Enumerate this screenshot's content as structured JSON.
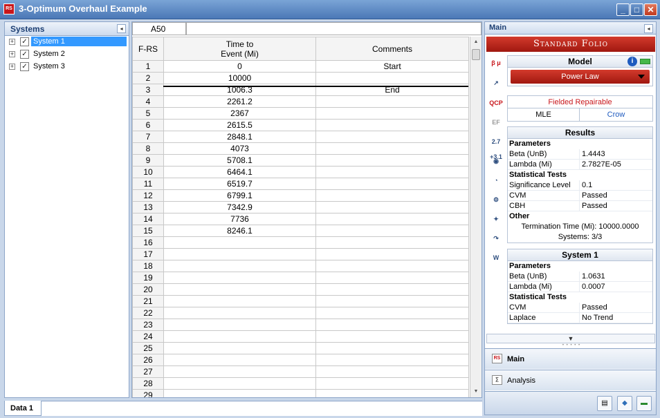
{
  "window": {
    "title": "3-Optimum Overhaul Example",
    "app_icon": "rs-app-icon",
    "min_label": "_",
    "max_label": "□",
    "close_label": "✕"
  },
  "systems_panel": {
    "title": "Systems",
    "collapse_glyph": "◂",
    "items": [
      {
        "label": "System 1",
        "checked": "✓",
        "expander": "+"
      },
      {
        "label": "System 2",
        "checked": "✓",
        "expander": "+"
      },
      {
        "label": "System 3",
        "checked": "✓",
        "expander": "+"
      }
    ]
  },
  "bottom_tab": {
    "label": "Data 1"
  },
  "grid": {
    "cell_ref": "A50",
    "formula": "",
    "columns": {
      "row_header": "F-RS",
      "time_line1": "Time to",
      "time_line2": "Event (Mi)",
      "comments": "Comments"
    },
    "rows": [
      {
        "n": "1",
        "time": "0",
        "comment": "Start"
      },
      {
        "n": "2",
        "time": "10000",
        "comment": ""
      },
      {
        "n": "3",
        "time": "1006.3",
        "comment": "End"
      },
      {
        "n": "4",
        "time": "2261.2",
        "comment": ""
      },
      {
        "n": "5",
        "time": "2367",
        "comment": ""
      },
      {
        "n": "6",
        "time": "2615.5",
        "comment": ""
      },
      {
        "n": "7",
        "time": "2848.1",
        "comment": ""
      },
      {
        "n": "8",
        "time": "4073",
        "comment": ""
      },
      {
        "n": "9",
        "time": "5708.1",
        "comment": ""
      },
      {
        "n": "10",
        "time": "6464.1",
        "comment": ""
      },
      {
        "n": "11",
        "time": "6519.7",
        "comment": ""
      },
      {
        "n": "12",
        "time": "6799.1",
        "comment": ""
      },
      {
        "n": "13",
        "time": "7342.9",
        "comment": ""
      },
      {
        "n": "14",
        "time": "7736",
        "comment": ""
      },
      {
        "n": "15",
        "time": "8246.1",
        "comment": ""
      },
      {
        "n": "16",
        "time": "",
        "comment": ""
      },
      {
        "n": "17",
        "time": "",
        "comment": ""
      },
      {
        "n": "18",
        "time": "",
        "comment": ""
      },
      {
        "n": "19",
        "time": "",
        "comment": ""
      },
      {
        "n": "20",
        "time": "",
        "comment": ""
      },
      {
        "n": "21",
        "time": "",
        "comment": ""
      },
      {
        "n": "22",
        "time": "",
        "comment": ""
      },
      {
        "n": "23",
        "time": "",
        "comment": ""
      },
      {
        "n": "24",
        "time": "",
        "comment": ""
      },
      {
        "n": "25",
        "time": "",
        "comment": ""
      },
      {
        "n": "26",
        "time": "",
        "comment": ""
      },
      {
        "n": "27",
        "time": "",
        "comment": ""
      },
      {
        "n": "28",
        "time": "",
        "comment": ""
      },
      {
        "n": "29",
        "time": "",
        "comment": ""
      }
    ]
  },
  "main_panel": {
    "title": "Main",
    "collapse_glyph": "◂",
    "banner": "Standard Folio",
    "toolbar_icons": [
      {
        "name": "beta-mu-icon",
        "glyph": "β μ"
      },
      {
        "name": "plot-icon",
        "glyph": "↗"
      },
      {
        "name": "qcp-icon",
        "glyph": "QCP"
      },
      {
        "name": "ef-icon",
        "glyph": "EF"
      },
      {
        "name": "calculator-icon",
        "glyph": "2.7 +3.1"
      },
      {
        "name": "eye-icon",
        "glyph": "◉"
      },
      {
        "name": "gauge-icon",
        "glyph": "◔"
      },
      {
        "name": "settings-gears-icon",
        "glyph": "⚙"
      },
      {
        "name": "wizard-icon",
        "glyph": "✦"
      },
      {
        "name": "redo-icon",
        "glyph": "↷"
      },
      {
        "name": "weibull-word-icon",
        "glyph": "W"
      }
    ],
    "model": {
      "title": "Model",
      "info_glyph": "i",
      "selected": "Power Law",
      "data_type": "Fielded Repairable",
      "method_left": "MLE",
      "method_right": "Crow",
      "accent": "#c8161b"
    },
    "results": {
      "title": "Results",
      "parameters_label": "Parameters",
      "params": [
        {
          "k": "Beta (UnB)",
          "v": "1.4443"
        },
        {
          "k": "Lambda (Mi)",
          "v": "2.7827E-05"
        }
      ],
      "stat_label": "Statistical Tests",
      "stats": [
        {
          "k": "Significance Level",
          "v": "0.1"
        },
        {
          "k": "CVM",
          "v": "Passed"
        },
        {
          "k": "CBH",
          "v": "Passed"
        }
      ],
      "other_label": "Other",
      "termination": "Termination Time (Mi): 10000.0000",
      "systems": "Systems: 3/3"
    },
    "system1": {
      "title": "System 1",
      "parameters_label": "Parameters",
      "params": [
        {
          "k": "Beta (UnB)",
          "v": "1.0631"
        },
        {
          "k": "Lambda (Mi)",
          "v": "0.0007"
        }
      ],
      "stat_label": "Statistical Tests",
      "stats": [
        {
          "k": "CVM",
          "v": "Passed"
        },
        {
          "k": "Laplace",
          "v": "No Trend"
        }
      ]
    },
    "scroll_glyph": "▼",
    "grip": "• • • • •",
    "nav": [
      {
        "label": "Main",
        "icon": "main-folio-icon",
        "glyph": "RS"
      },
      {
        "label": "Analysis",
        "icon": "analysis-icon",
        "glyph": "∑"
      }
    ],
    "bottom_tools": [
      {
        "name": "report-icon",
        "glyph": "▤"
      },
      {
        "name": "diamond-tool-icon",
        "glyph": "◆"
      },
      {
        "name": "minimize-bar-icon",
        "glyph": "▬"
      }
    ]
  }
}
